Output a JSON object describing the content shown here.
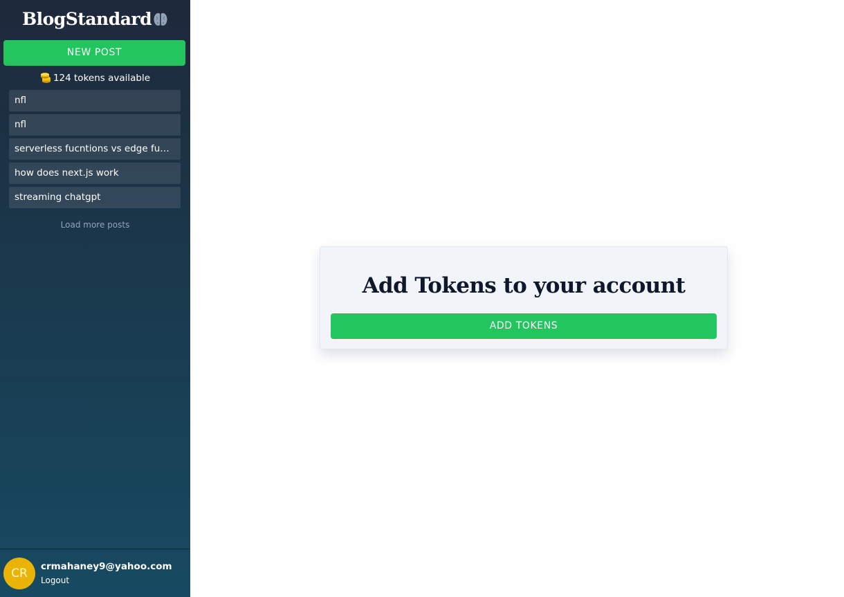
{
  "sidebar": {
    "logo_text": "BlogStandard",
    "logo_icon": "brain-icon",
    "new_post_label": "NEW POST",
    "tokens_text": "124 tokens available",
    "tokens_icon": "coins-icon",
    "posts": [
      {
        "title": "nfl"
      },
      {
        "title": "nfl"
      },
      {
        "title": "serverless fucntions vs edge functions"
      },
      {
        "title": "how does next.js work"
      },
      {
        "title": "streaming chatgpt"
      }
    ],
    "load_more_label": "Load more posts",
    "user": {
      "initials": "CR",
      "email": "crmahaney9@yahoo.com",
      "logout_label": "Logout"
    }
  },
  "main": {
    "card_title": "Add Tokens to your account",
    "add_tokens_label": "ADD TOKENS"
  },
  "colors": {
    "accent_green": "#22c55e",
    "avatar_yellow": "#eab308",
    "sidebar_top": "#1e293b",
    "sidebar_bottom": "#174a62"
  }
}
